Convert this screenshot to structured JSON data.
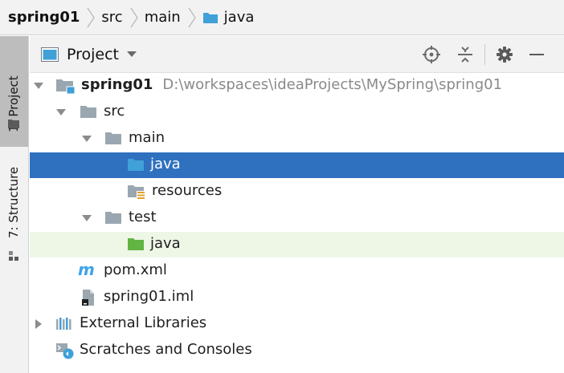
{
  "breadcrumb": {
    "items": [
      {
        "label": "spring01"
      },
      {
        "label": "src"
      },
      {
        "label": "main"
      },
      {
        "label": "java"
      }
    ]
  },
  "left_strip": {
    "project_tab": "1: Project",
    "structure_tab": "7: Structure"
  },
  "panel_header": {
    "view_label": "Project",
    "tools": [
      "locate-icon",
      "collapse-all-icon",
      "gear-icon",
      "hide-icon"
    ]
  },
  "tree": {
    "root": {
      "label": "spring01",
      "path": "D:\\workspaces\\ideaProjects\\MySpring\\spring01"
    },
    "src": "src",
    "main": "main",
    "main_java": "java",
    "resources": "resources",
    "test": "test",
    "test_java": "java",
    "pom": "pom.xml",
    "iml": "spring01.iml",
    "external_libraries": "External Libraries",
    "scratches": "Scratches and Consoles"
  },
  "colors": {
    "selection": "#2f71bf",
    "test_highlight": "#eef6e6",
    "folder_gray": "#9aa7b0",
    "source_folder_blue": "#40a0d8",
    "test_folder_green": "#62b543",
    "maven_blue": "#3ea3ea"
  }
}
